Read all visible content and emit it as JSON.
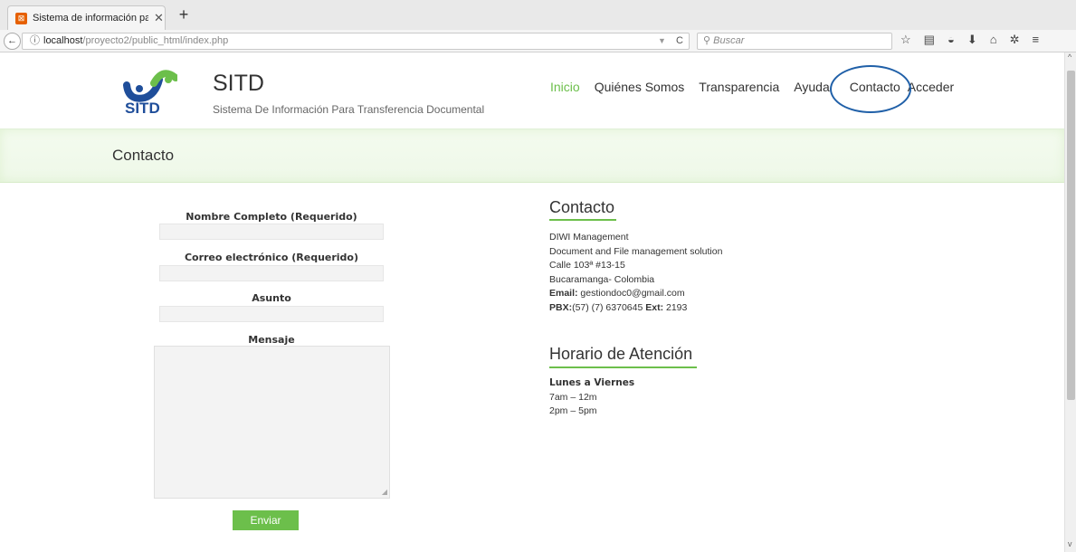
{
  "browser": {
    "tab_title": "Sistema de información par",
    "url_host": "localhost",
    "url_path": "/proyecto2/public_html/index.php",
    "search_placeholder": "Buscar"
  },
  "site": {
    "logo_text": "SITD",
    "title": "SITD",
    "subtitle": "Sistema De Información Para Transferencia Documental",
    "menu": [
      "Inicio",
      "Quiénes Somos",
      "Transparencia",
      "Ayuda",
      "Contacto",
      "Acceder"
    ]
  },
  "banner": {
    "title": "Contacto"
  },
  "form": {
    "name_label": "Nombre Completo (Requerido)",
    "email_label": "Correo electrónico (Requerido)",
    "subject_label": "Asunto",
    "message_label": "Mensaje",
    "submit": "Enviar"
  },
  "contact": {
    "title": "Contacto",
    "company": "DIWI Management",
    "tagline": "Document and File management solution",
    "address": "Calle 103ª #13-15",
    "city": "Bucaramanga- Colombia",
    "email_label": "Email:",
    "email": " gestiondoc0@gmail.com",
    "pbx_label": "PBX:",
    "pbx": "(57) (7) 6370645 ",
    "ext_label": "Ext:",
    "ext": " 2193"
  },
  "schedule": {
    "title": "Horario de Atención",
    "days": "Lunes a Viernes",
    "morning": "7am – 12m",
    "afternoon": "2pm – 5pm"
  },
  "colors": {
    "accent": "#6cbf4b",
    "highlight_circle": "#2060a8"
  }
}
